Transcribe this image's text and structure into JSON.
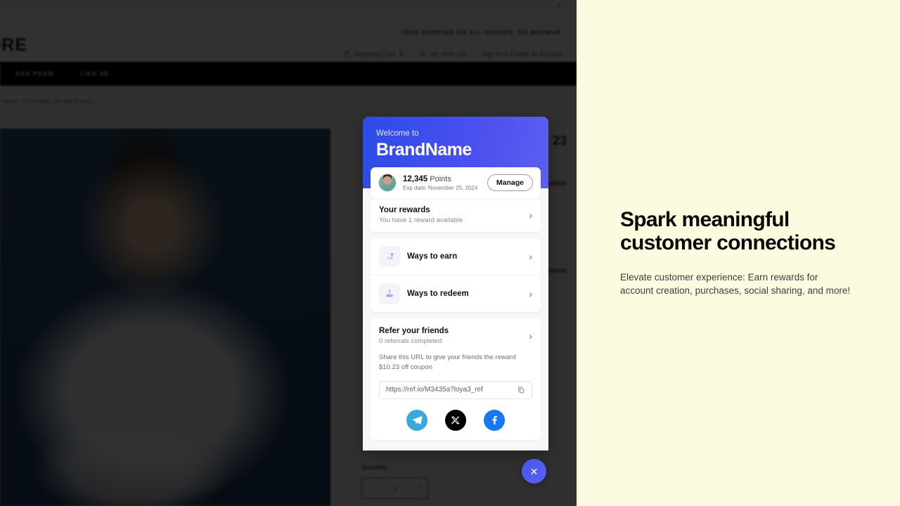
{
  "storefront": {
    "logo": "TORE",
    "shipping_note": "FREE SHIPPING ON ALL ORDERS, NO MINIMUM",
    "cart_label": "Shopping Cart",
    "cart_count": "0",
    "wishlist_label": "My Wish List",
    "account_label": "Sign in or Create an Account",
    "nav": [
      "SAN PHAM",
      "LIEN HE"
    ],
    "breadcrumb": "Home / Top Selling / Bla Bla Product",
    "price": "23",
    "quantity_label": "Quantity",
    "quantity_minus": "−",
    "quantity_value": "1",
    "quantity_plus": "+"
  },
  "promo": {
    "headline": "Spark meaningful customer connections",
    "subtext": "Elevate customer experience: Earn rewards for account creation, purchases, social sharing, and more!"
  },
  "widget": {
    "welcome_label": "Welcome to",
    "brand_name": "BrandName",
    "points": {
      "value": "12,345",
      "unit": "Points",
      "expiry": "Exp date: November 25, 2024",
      "manage_label": "Manage"
    },
    "rewards": {
      "title": "Your rewards",
      "subtitle": "You have 1 reward available"
    },
    "actions": [
      {
        "title": "Ways to earn",
        "icon": "earn-coin-icon"
      },
      {
        "title": "Ways to redeem",
        "icon": "redeem-gift-icon"
      }
    ],
    "referral": {
      "title": "Refer your friends",
      "subtitle": "0 referrals completed",
      "note": "Share this URL to give your friends the reward $10.23 off coupon",
      "url": "https://ref.io/M3435a?loya3_ref",
      "copy_icon": "copy-icon",
      "socials": [
        "telegram-icon",
        "x-twitter-icon",
        "facebook-icon"
      ]
    },
    "close_label": "✕"
  },
  "colors": {
    "gradient_start": "#2b4be8",
    "gradient_end": "#5d5ef2",
    "promo_bg": "#fcfbe0",
    "accent": "#4458ee"
  }
}
